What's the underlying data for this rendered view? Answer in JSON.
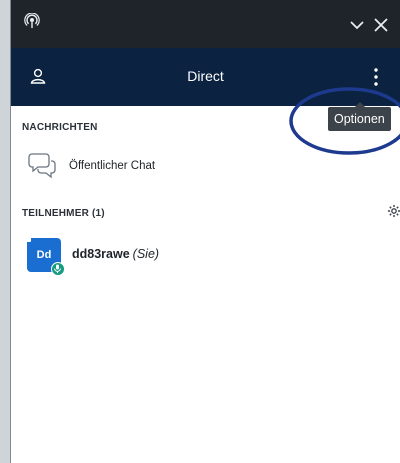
{
  "header": {
    "title": "Direct"
  },
  "tooltip": {
    "label": "Optionen"
  },
  "sections": {
    "messages": {
      "label": "NACHRICHTEN",
      "items": [
        {
          "label": "Öffentlicher Chat"
        }
      ]
    },
    "participants": {
      "label": "TEILNEHMER (1)"
    }
  },
  "participants": [
    {
      "initials": "Dd",
      "name": "dd83rawe",
      "you_label": "(Sie)"
    }
  ],
  "colors": {
    "titlebar": "#1f242b",
    "header": "#0b2340",
    "avatar": "#1b6ed1",
    "mic_badge": "#149b80",
    "annotation_ellipse": "#1d3a8f"
  },
  "icons": {
    "titlebar": [
      "podcast-icon",
      "chevron-down-icon",
      "close-icon"
    ],
    "header": [
      "user-icon",
      "more-options-icon"
    ],
    "messages": [
      "chat-bubbles-icon"
    ],
    "participants": [
      "gear-icon",
      "microphone-icon"
    ]
  }
}
